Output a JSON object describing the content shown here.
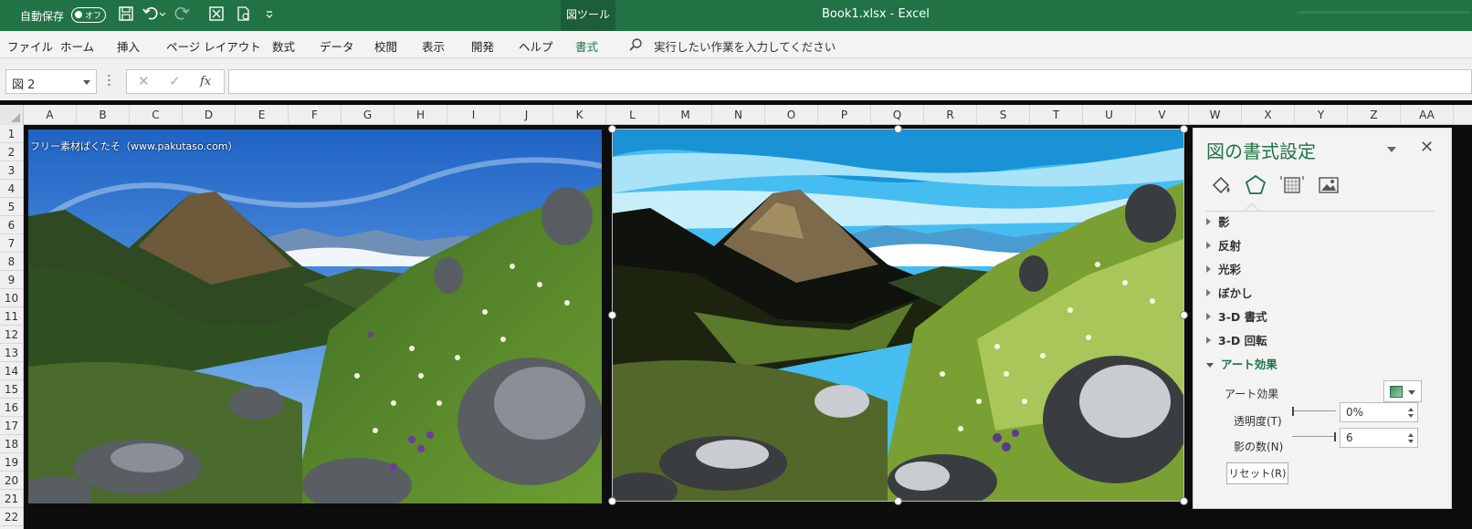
{
  "titlebar": {
    "autosave_label": "自動保存",
    "autosave_state": "オフ",
    "context_tab": "図ツール",
    "doc_title": "Book1.xlsx  -  Excel",
    "accent": "#217346"
  },
  "ribbon": {
    "tabs": [
      "ファイル",
      "ホーム",
      "挿入",
      "ページ レイアウト",
      "数式",
      "データ",
      "校閲",
      "表示",
      "開発",
      "ヘルプ",
      "書式"
    ],
    "active_tab": "書式",
    "tell_me": "実行したい作業を入力してください"
  },
  "formula_bar": {
    "name_box": "図 2",
    "cancel": "✕",
    "enter": "✓",
    "fx": "fx",
    "value": ""
  },
  "grid": {
    "columns": [
      "A",
      "B",
      "C",
      "D",
      "E",
      "F",
      "G",
      "H",
      "I",
      "J",
      "K",
      "L",
      "M",
      "N",
      "O",
      "P",
      "Q",
      "R",
      "S",
      "T",
      "U",
      "V",
      "W",
      "X",
      "Y",
      "Z",
      "AA"
    ],
    "rows": [
      "1",
      "2",
      "3",
      "4",
      "5",
      "6",
      "7",
      "8",
      "9",
      "10",
      "11",
      "12",
      "13",
      "14",
      "15",
      "16",
      "17",
      "18",
      "19",
      "20",
      "21",
      "22"
    ]
  },
  "picture1": {
    "watermark": "フリー素材ぱくたそ（www.pakutaso.com）"
  },
  "format_pane": {
    "title": "図の書式設定",
    "close": "✕",
    "sections": [
      "影",
      "反射",
      "光彩",
      "ぼかし",
      "3-D 書式",
      "3-D 回転",
      "アート効果"
    ],
    "open_section": "アート効果",
    "art_effect_label": "アート効果",
    "transparency_label": "透明度(T)",
    "transparency_value": "0%",
    "transparency_level": 0,
    "shadow_count_label": "影の数(N)",
    "shadow_count_value": "6",
    "shadow_count_level": 1,
    "reset_label": "リセット(R)"
  }
}
